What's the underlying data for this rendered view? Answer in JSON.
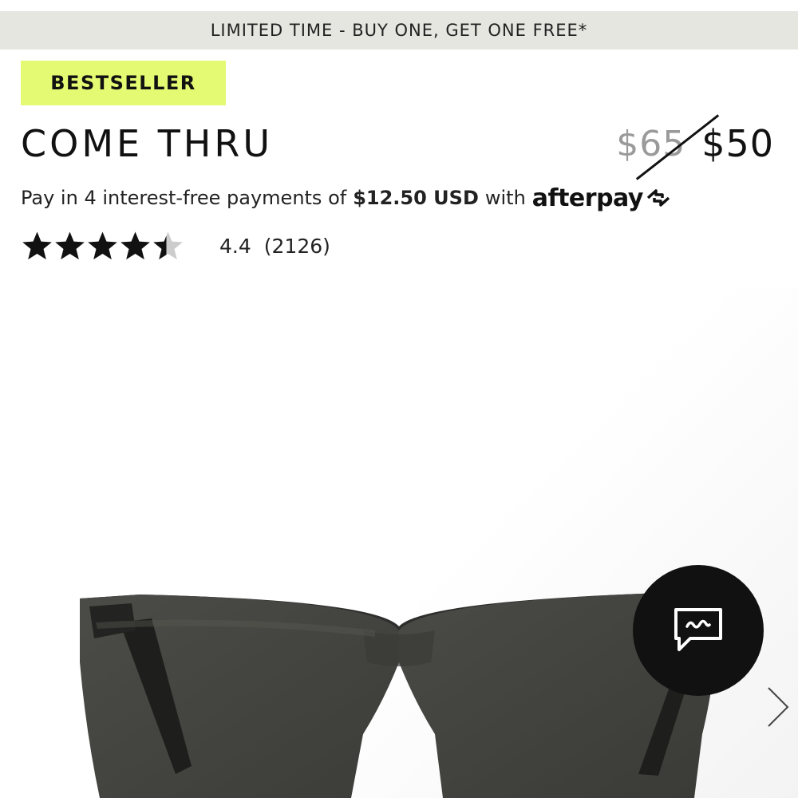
{
  "promo": {
    "text": "LIMITED TIME - BUY ONE, GET ONE FREE*"
  },
  "product": {
    "badge": "BESTSELLER",
    "name": "COME THRU",
    "original_price": "$65",
    "sale_price": "$50",
    "afterpay": {
      "prefix": "Pay in 4 interest-free payments of",
      "amount": "$12.50 USD",
      "suffix": "with",
      "brand": "afterpay"
    },
    "rating": {
      "value": "4.4",
      "count": "(2126)",
      "stars_filled": 4.4,
      "stars_total": 5
    }
  },
  "icons": {
    "chat": "chat-icon",
    "next": "chevron-right-icon",
    "star": "star-icon"
  },
  "colors": {
    "badge_bg": "#e4fa72",
    "promo_bg": "#e6e6e0",
    "chat_bg": "#111111",
    "star_fill": "#111111",
    "star_empty": "#cccccc"
  }
}
